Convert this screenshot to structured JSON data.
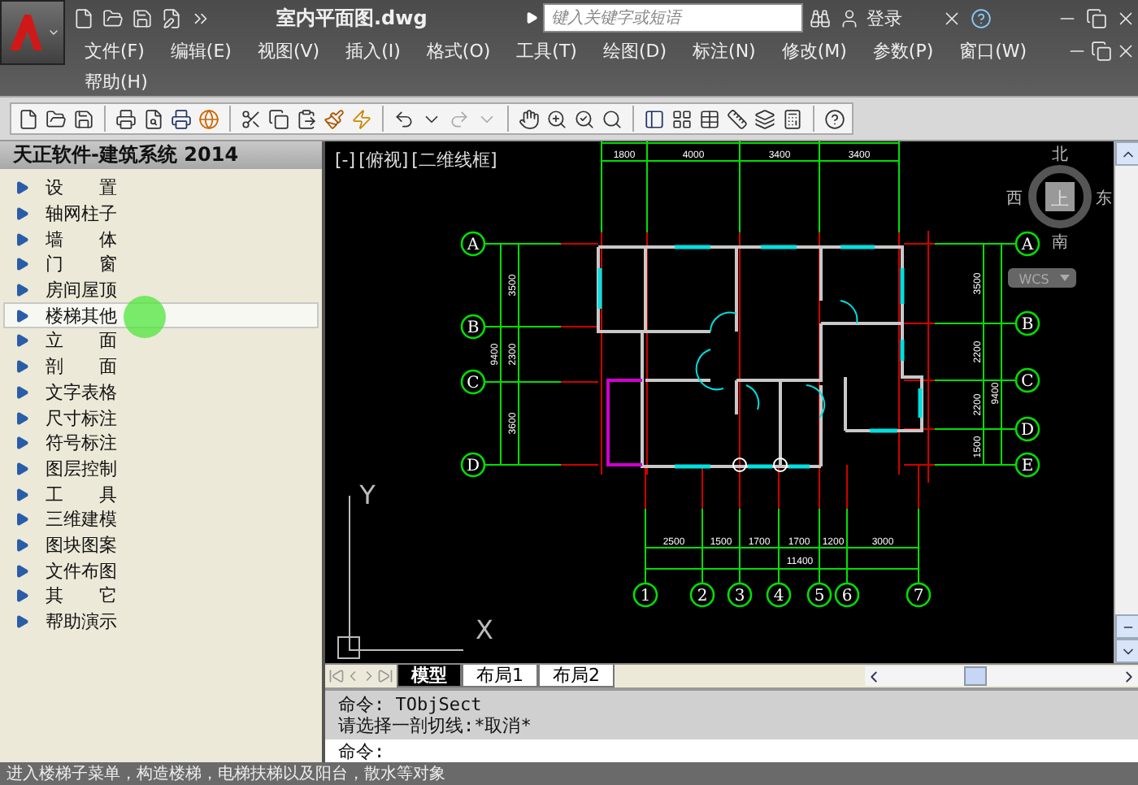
{
  "title_bar": {
    "file_name": "室内平面图.dwg",
    "search": {
      "placeholder": "键入关键字或短语"
    },
    "login": "登录"
  },
  "menu": [
    {
      "label": "文件(F)"
    },
    {
      "label": "编辑(E)"
    },
    {
      "label": "视图(V)"
    },
    {
      "label": "插入(I)"
    },
    {
      "label": "格式(O)"
    },
    {
      "label": "工具(T)"
    },
    {
      "label": "绘图(D)"
    },
    {
      "label": "标注(N)"
    },
    {
      "label": "修改(M)"
    },
    {
      "label": "参数(P)"
    },
    {
      "label": "窗口(W)"
    },
    {
      "label": "帮助(H)"
    }
  ],
  "panel": {
    "title": "天正软件-建筑系统 2014",
    "items": [
      {
        "label": "设　　置",
        "hovered": false
      },
      {
        "label": "轴网柱子",
        "hovered": false
      },
      {
        "label": "墙　　体",
        "hovered": false
      },
      {
        "label": "门　　窗",
        "hovered": false
      },
      {
        "label": "房间屋顶",
        "hovered": false
      },
      {
        "label": "楼梯其他",
        "hovered": true
      },
      {
        "label": "立　　面",
        "hovered": false
      },
      {
        "label": "剖　　面",
        "hovered": false
      },
      {
        "label": "文字表格",
        "hovered": false
      },
      {
        "label": "尺寸标注",
        "hovered": false
      },
      {
        "label": "符号标注",
        "hovered": false
      },
      {
        "label": "图层控制",
        "hovered": false
      },
      {
        "label": "工　　具",
        "hovered": false
      },
      {
        "label": "三维建模",
        "hovered": false
      },
      {
        "label": "图块图案",
        "hovered": false
      },
      {
        "label": "文件布图",
        "hovered": false
      },
      {
        "label": "其　　它",
        "hovered": false
      },
      {
        "label": "帮助演示",
        "hovered": false
      }
    ]
  },
  "viewport": {
    "view_controls": [
      "[-]",
      "[俯视]",
      "[二维线框]"
    ],
    "compass": {
      "north": "北",
      "west": "西",
      "east": "东",
      "south": "南",
      "top": "上"
    },
    "ucs_menu": "WCS",
    "ucs_axes": {
      "y": "Y",
      "x": "X"
    },
    "plan": {
      "top_dims": [
        "1800",
        "4000",
        "3400",
        "3400"
      ],
      "bottom_dims": [
        "2500",
        "1500",
        "1700",
        "1700",
        "1200",
        "3000"
      ],
      "bottom_total": "11400",
      "left_axes": [
        "A",
        "B",
        "C",
        "D"
      ],
      "right_axes": [
        "A",
        "B",
        "C",
        "D",
        "E"
      ],
      "bottom_axes": [
        "1",
        "2",
        "3",
        "4",
        "5",
        "6",
        "7"
      ],
      "left_dims": [
        "3500",
        "2300",
        "3600"
      ],
      "left_total": "9400",
      "right_dims": [
        "3500",
        "2200",
        "2200",
        "1500"
      ],
      "right_total": "9400"
    }
  },
  "layout_tabs": [
    {
      "label": "模型",
      "selected": true
    },
    {
      "label": "布局1",
      "selected": false
    },
    {
      "label": "布局2",
      "selected": false
    }
  ],
  "command": {
    "history": [
      "命令: TObjSect",
      "请选择一剖切线:*取消*"
    ],
    "prompt": "命令:"
  },
  "status_bar": "进入楼梯子菜单，构造楼梯，电梯扶梯以及阳台，散水等对象"
}
